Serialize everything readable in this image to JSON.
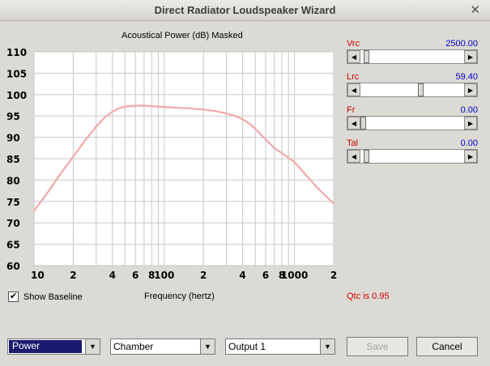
{
  "window": {
    "title": "Direct Radiator Loudspeaker Wizard",
    "close_glyph": "✕"
  },
  "chart_title": "Acoustical Power (dB)   Masked",
  "chart_data": {
    "type": "line",
    "title": "Acoustical Power (dB)   Masked",
    "xlabel": "Frequency (hertz)",
    "ylabel": "",
    "xscale": "log",
    "xlim": [
      10,
      2000
    ],
    "ylim": [
      60,
      110
    ],
    "y_ticks": [
      60,
      65,
      70,
      75,
      80,
      85,
      90,
      95,
      100,
      105,
      110
    ],
    "x_tick_labels": [
      {
        "v": 10,
        "label": "10"
      },
      {
        "v": 20,
        "label": "2"
      },
      {
        "v": 40,
        "label": "4"
      },
      {
        "v": 60,
        "label": "6"
      },
      {
        "v": 80,
        "label": "8"
      },
      {
        "v": 100,
        "label": "100"
      },
      {
        "v": 200,
        "label": "2"
      },
      {
        "v": 400,
        "label": "4"
      },
      {
        "v": 600,
        "label": "6"
      },
      {
        "v": 800,
        "label": "8"
      },
      {
        "v": 1000,
        "label": "1000"
      },
      {
        "v": 2000,
        "label": "2"
      }
    ],
    "grid": true,
    "line_color": "#f4a8a8",
    "series": [
      {
        "x": [
          10,
          13,
          16,
          20,
          25,
          30,
          35,
          40,
          45,
          50,
          60,
          70,
          80,
          100,
          150,
          200,
          250,
          300,
          350,
          400,
          450,
          500,
          600,
          700,
          800,
          900,
          1000,
          1200,
          1500,
          2000
        ],
        "values": [
          72.8,
          77.5,
          81.5,
          85.5,
          89.5,
          92.5,
          94.7,
          96.0,
          96.8,
          97.2,
          97.4,
          97.4,
          97.3,
          97.1,
          96.8,
          96.5,
          96.1,
          95.6,
          95.0,
          94.2,
          93.2,
          92.0,
          89.5,
          87.5,
          86.3,
          85.2,
          84.2,
          81.5,
          78.2,
          74.5
        ]
      }
    ]
  },
  "baseline": {
    "label": "Show Baseline",
    "checked": true
  },
  "params": [
    {
      "name": "Vrc",
      "value": "2500.00",
      "pos": 0.03
    },
    {
      "name": "Lrc",
      "value": "59.40",
      "pos": 0.59
    },
    {
      "name": "Fr",
      "value": "0.00",
      "pos": 0.0
    },
    {
      "name": "Tal",
      "value": "0.00",
      "pos": 0.03
    }
  ],
  "qtc": "Qtc is 0.95",
  "selects": {
    "type": "Power",
    "enclosure": "Chamber",
    "output": "Output 1"
  },
  "buttons": {
    "save": "Save",
    "cancel": "Cancel"
  },
  "glyphs": {
    "left": "◀",
    "right": "▶",
    "down": "▼"
  }
}
